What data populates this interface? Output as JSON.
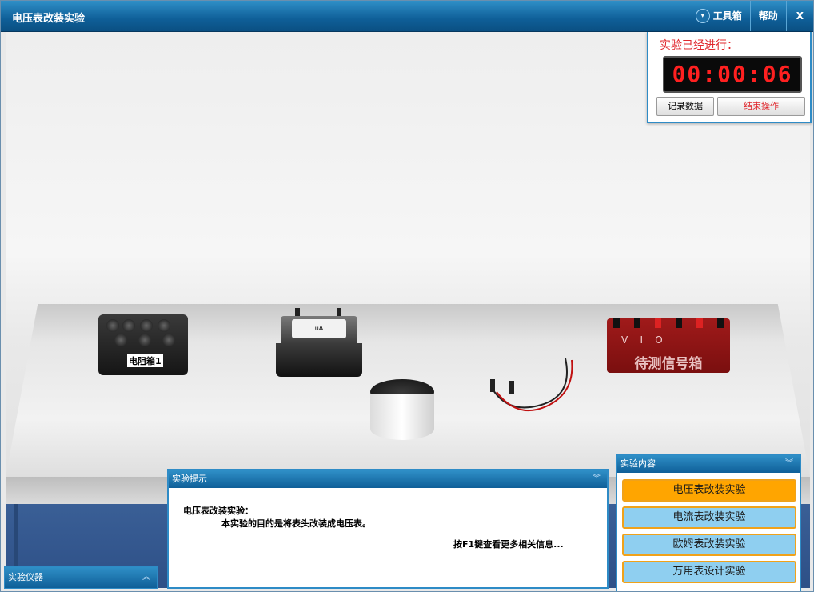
{
  "window": {
    "title": "电压表改装实验",
    "toolbox_label": "工具箱",
    "help_label": "帮助",
    "close_label": "X"
  },
  "timer": {
    "title": "实验已经进行：",
    "time": "00:00:06",
    "record_label": "记录数据",
    "end_label": "结束操作"
  },
  "instruments": {
    "resistor_box_label": "电阻箱1",
    "signal_box_label": "待测信号箱",
    "signal_box_letters": "V    I    O",
    "meter_label": "uA"
  },
  "hint_panel": {
    "title": "实验提示",
    "line1": "电压表改装实验：",
    "line2": "本实验的目的是将表头改装成电压表。",
    "more": "按F1键查看更多相关信息..."
  },
  "content_panel": {
    "title": "实验内容",
    "items": [
      "电压表改装实验",
      "电流表改装实验",
      "欧姆表改装实验",
      "万用表设计实验"
    ],
    "active_index": 0
  },
  "instrument_panel": {
    "title": "实验仪器"
  },
  "colors": {
    "header_blue": "#0f5f98",
    "active_item": "#ffa500",
    "item_bg": "#8fcff0",
    "timer_red": "#ff2020"
  }
}
